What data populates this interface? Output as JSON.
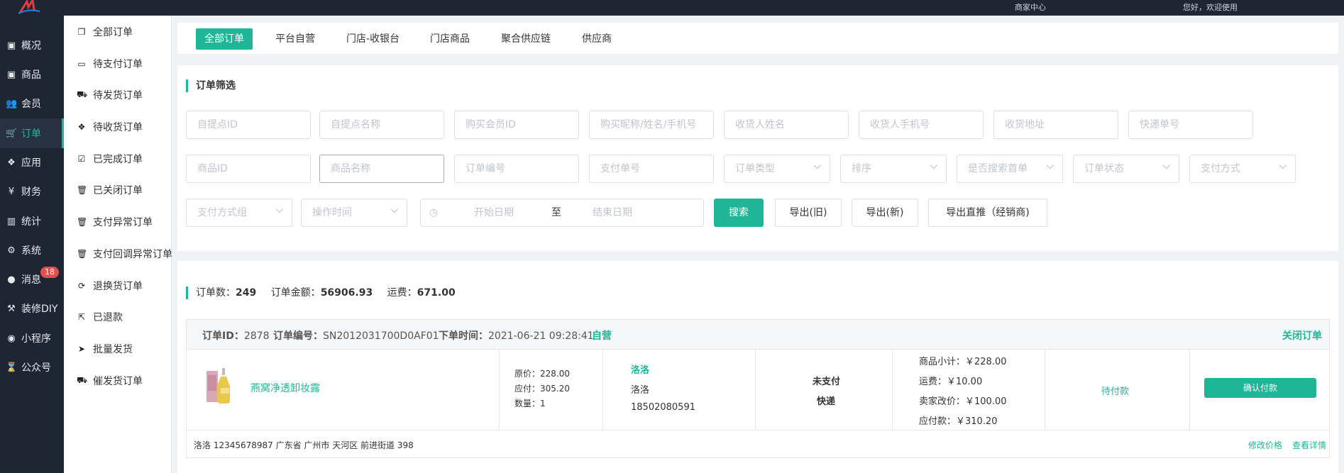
{
  "header": {
    "right_text_1": "商家中心",
    "right_text_2": "您好，欢迎使用"
  },
  "sidebar": {
    "items": [
      {
        "label": "概况",
        "icon": "box-icon"
      },
      {
        "label": "商品",
        "icon": "box-icon"
      },
      {
        "label": "会员",
        "icon": "users-icon"
      },
      {
        "label": "订单",
        "icon": "cart-icon",
        "active": true
      },
      {
        "label": "应用",
        "icon": "cubes-icon"
      },
      {
        "label": "财务",
        "icon": "yen-icon"
      },
      {
        "label": "统计",
        "icon": "bar-chart-icon"
      },
      {
        "label": "系统",
        "icon": "gears-icon"
      },
      {
        "label": "消息",
        "icon": "chat-icon",
        "badge": "18"
      },
      {
        "label": "装修DIY",
        "icon": "gavel-icon"
      },
      {
        "label": "小程序",
        "icon": "wechat-icon"
      },
      {
        "label": "公众号",
        "icon": "hourglass-icon"
      }
    ]
  },
  "subnav": {
    "items": [
      {
        "label": "全部订单",
        "icon": "copy-icon"
      },
      {
        "label": "待支付订单",
        "icon": "credit-card-icon"
      },
      {
        "label": "待发货订单",
        "icon": "truck-icon"
      },
      {
        "label": "待收货订单",
        "icon": "dropbox-icon"
      },
      {
        "label": "已完成订单",
        "icon": "check-square-icon"
      },
      {
        "label": "已关闭订单",
        "icon": "trash-icon"
      },
      {
        "label": "支付异常订单",
        "icon": "trash-icon"
      },
      {
        "label": "支付回调异常订单",
        "icon": "trash-icon"
      },
      {
        "label": "退换货订单",
        "icon": "refresh-icon"
      },
      {
        "label": "已退款",
        "icon": "share-icon"
      },
      {
        "label": "批量发货",
        "icon": "send-icon"
      },
      {
        "label": "催发货订单",
        "icon": "truck-icon"
      }
    ]
  },
  "tabs": [
    "全部订单",
    "平台自营",
    "门店-收银台",
    "门店商品",
    "聚合供应链",
    "供应商"
  ],
  "filter": {
    "title": "订单筛选",
    "row1": [
      "自提点ID",
      "自提点名称",
      "购买会员ID",
      "购买昵称/姓名/手机号",
      "收货人姓名",
      "收货人手机号",
      "收货地址",
      "快递单号"
    ],
    "row2_inputs": [
      "商品ID",
      "商品名称",
      "订单编号",
      "支付单号"
    ],
    "row2_selects": [
      "订单类型",
      "排序",
      "是否搜索首单",
      "订单状态",
      "支付方式"
    ],
    "row3_selects": [
      "支付方式组",
      "操作时间"
    ],
    "date_start": "开始日期",
    "date_sep": "至",
    "date_end": "结束日期",
    "search_btn": "搜索",
    "export_old": "导出(旧)",
    "export_new": "导出(新)",
    "export_direct": "导出直推（经销商)"
  },
  "summary": {
    "count_label": "订单数：",
    "count": "249",
    "amount_label": "订单金额：",
    "amount": "56906.93",
    "freight_label": "运费：",
    "freight": "671.00"
  },
  "order": {
    "id_label": "订单ID：",
    "id": "2878",
    "sn_label": "订单编号：",
    "sn": "SN2012031700D0AF01",
    "time_label": "下单时间：",
    "time": "2021-06-21 09:28:41",
    "tag": "自营",
    "close": "关闭订单",
    "product_name": "燕窝净透卸妆露",
    "original_price": "原价：228.00",
    "pay_price": "应付：305.20",
    "quantity": "数量：1",
    "buyer_link": "洛洛",
    "buyer_name": "洛洛",
    "buyer_phone": "18502080591",
    "pay_status": "未支付",
    "delivery": "快递",
    "subtotal": "商品小计：￥228.00",
    "freight": "运费：￥10.00",
    "seller_adjust": "卖家改价：￥100.00",
    "payable": "应付款：￥310.20",
    "status": "待付款",
    "confirm_btn": "确认付款",
    "address_line": "洛洛   12345678987   广东省 广州市 天河区 前进街道 398",
    "edit_price": "修改价格",
    "view_detail": "查看详情"
  },
  "colors": {
    "accent": "#1fb698",
    "sidebar_bg": "#1f2633",
    "badge": "#e64d4d"
  }
}
